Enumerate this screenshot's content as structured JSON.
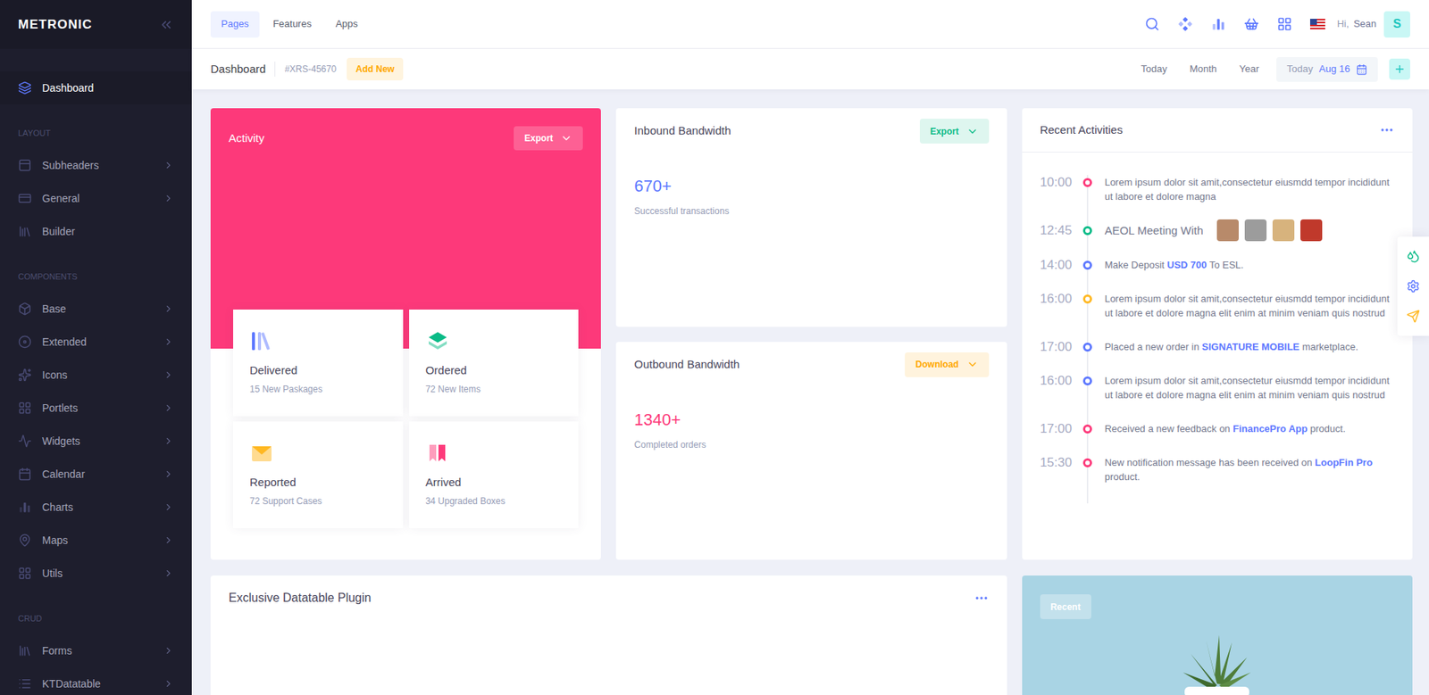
{
  "brand": "METRONIC",
  "sidebar": {
    "items": [
      {
        "kind": "item",
        "label": "Dashboard",
        "selected": true,
        "submenu": false
      },
      {
        "kind": "section",
        "label": "LAYOUT"
      },
      {
        "kind": "item",
        "label": "Subheaders",
        "selected": false,
        "submenu": true
      },
      {
        "kind": "item",
        "label": "General",
        "selected": false,
        "submenu": true
      },
      {
        "kind": "item",
        "label": "Builder",
        "selected": false,
        "submenu": false
      },
      {
        "kind": "section",
        "label": "COMPONENTS"
      },
      {
        "kind": "item",
        "label": "Base",
        "selected": false,
        "submenu": true
      },
      {
        "kind": "item",
        "label": "Extended",
        "selected": false,
        "submenu": true
      },
      {
        "kind": "item",
        "label": "Icons",
        "selected": false,
        "submenu": true
      },
      {
        "kind": "item",
        "label": "Portlets",
        "selected": false,
        "submenu": true
      },
      {
        "kind": "item",
        "label": "Widgets",
        "selected": false,
        "submenu": true
      },
      {
        "kind": "item",
        "label": "Calendar",
        "selected": false,
        "submenu": true
      },
      {
        "kind": "item",
        "label": "Charts",
        "selected": false,
        "submenu": true
      },
      {
        "kind": "item",
        "label": "Maps",
        "selected": false,
        "submenu": true
      },
      {
        "kind": "item",
        "label": "Utils",
        "selected": false,
        "submenu": true
      },
      {
        "kind": "section",
        "label": "CRUD"
      },
      {
        "kind": "item",
        "label": "Forms",
        "selected": false,
        "submenu": true
      },
      {
        "kind": "item",
        "label": "KTDatatable",
        "selected": false,
        "submenu": true
      }
    ]
  },
  "header": {
    "tabs": [
      {
        "label": "Pages",
        "selected": true
      },
      {
        "label": "Features",
        "selected": false
      },
      {
        "label": "Apps",
        "selected": false
      }
    ],
    "greeting": "Hi,",
    "user": "Sean",
    "avatar": "S"
  },
  "subheader": {
    "title": "Dashboard",
    "code": "#XRS-45670",
    "action": "Add New",
    "ranges": [
      {
        "label": "Today",
        "selected": false
      },
      {
        "label": "Month",
        "selected": false
      },
      {
        "label": "Year",
        "selected": false
      }
    ],
    "date_label": "Today",
    "date": "Aug 16"
  },
  "activity": {
    "title": "Activity",
    "button": "Export",
    "tiles": [
      {
        "label": "Delivered",
        "sub": "15 New Paskages",
        "color": "#5d78ff"
      },
      {
        "label": "Ordered",
        "sub": "72 New Items",
        "color": "#0abb87"
      },
      {
        "label": "Reported",
        "sub": "72 Support Cases",
        "color": "#ffb822"
      },
      {
        "label": "Arrived",
        "sub": "34 Upgraded Boxes",
        "color": "#fd397a"
      }
    ]
  },
  "bandwidth": [
    {
      "title": "Inbound Bandwidth",
      "button": "Export",
      "button_color": "#0abb87",
      "value": "670+",
      "caption": "Successful transactions",
      "color": "#5d78ff"
    },
    {
      "title": "Outbound Bandwidth",
      "button": "Download",
      "button_color": "#ffa800",
      "value": "1340+",
      "caption": "Completed orders",
      "color": "#fd397a"
    }
  ],
  "recent": {
    "title": "Recent Activities",
    "items": [
      {
        "time": "10:00",
        "color": "#fd397a",
        "kind": "text",
        "avatars": 0,
        "parts": [
          {
            "text": "Lorem ipsum dolor sit amit,consectetur eiusmdd tempor incididunt ut labore et dolore magna",
            "strong": false
          }
        ]
      },
      {
        "time": "12:45",
        "color": "#0abb87",
        "kind": "meeting",
        "avatars": 4,
        "parts": [
          {
            "text": "AEOL Meeting With",
            "strong": false
          }
        ]
      },
      {
        "time": "14:00",
        "color": "#5d78ff",
        "kind": "text",
        "avatars": 0,
        "parts": [
          {
            "text": "Make Deposit ",
            "strong": false
          },
          {
            "text": "USD 700",
            "strong": true
          },
          {
            "text": " To ESL.",
            "strong": false
          }
        ]
      },
      {
        "time": "16:00",
        "color": "#ffb822",
        "kind": "text",
        "avatars": 0,
        "parts": [
          {
            "text": "Lorem ipsum dolor sit amit,consectetur eiusmdd tempor incididunt ut labore et dolore magna elit enim at minim veniam quis nostrud",
            "strong": false
          }
        ]
      },
      {
        "time": "17:00",
        "color": "#5d78ff",
        "kind": "text",
        "avatars": 0,
        "parts": [
          {
            "text": "Placed a new order in ",
            "strong": false
          },
          {
            "text": "SIGNATURE MOBILE",
            "strong": true
          },
          {
            "text": " marketplace.",
            "strong": false
          }
        ]
      },
      {
        "time": "16:00",
        "color": "#5d78ff",
        "kind": "text",
        "avatars": 0,
        "parts": [
          {
            "text": "Lorem ipsum dolor sit amit,consectetur eiusmdd tempor incididunt ut labore et dolore magna elit enim at minim veniam quis nostrud",
            "strong": false
          }
        ]
      },
      {
        "time": "17:00",
        "color": "#fd397a",
        "kind": "text",
        "avatars": 0,
        "parts": [
          {
            "text": "Received a new feedback on ",
            "strong": false
          },
          {
            "text": "FinancePro App",
            "strong": true
          },
          {
            "text": " product.",
            "strong": false
          }
        ]
      },
      {
        "time": "15:30",
        "color": "#fd397a",
        "kind": "text",
        "avatars": 0,
        "parts": [
          {
            "text": "New notification message has been received on ",
            "strong": false
          },
          {
            "text": "LoopFin Pro",
            "strong": true
          },
          {
            "text": " product.",
            "strong": false
          }
        ]
      }
    ]
  },
  "datatable": {
    "title": "Exclusive Datatable Plugin"
  },
  "promo": {
    "badge": "Recent"
  }
}
